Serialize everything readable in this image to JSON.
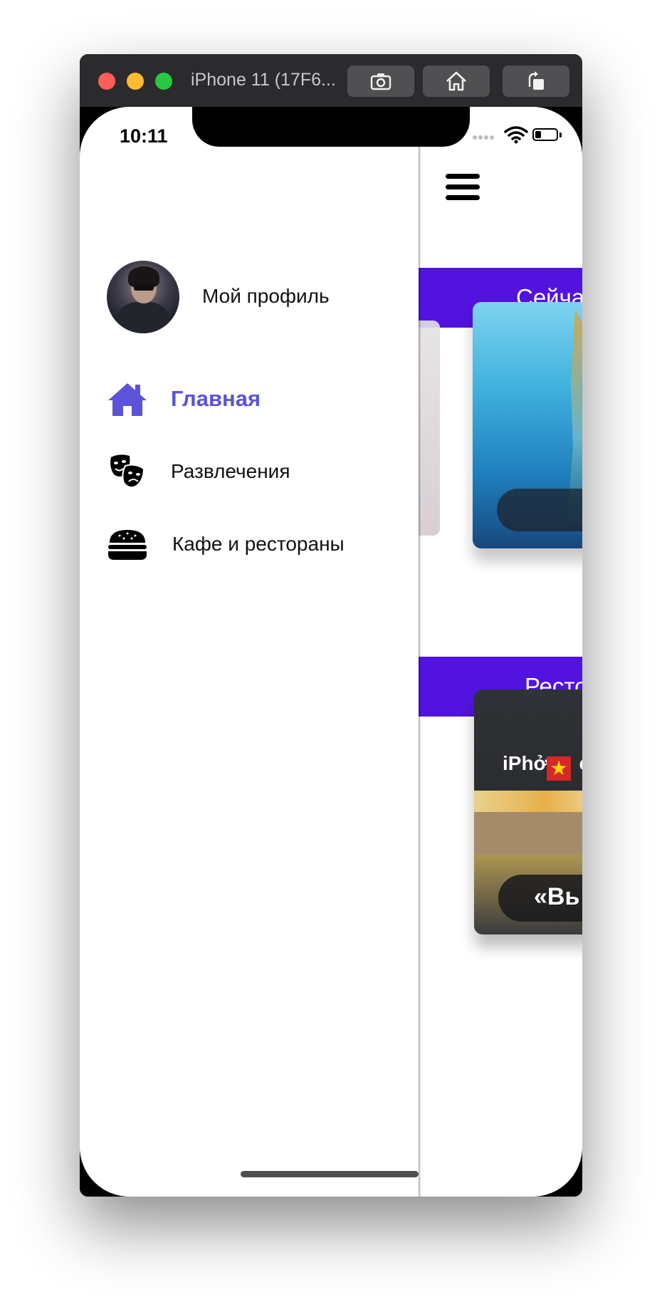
{
  "simulator": {
    "title": "iPhone 11 (17F6...",
    "buttons": {
      "screenshot": "screenshot-icon",
      "home": "home-icon",
      "rotate": "rotate-icon"
    }
  },
  "status_bar": {
    "time": "10:11"
  },
  "drawer": {
    "profile": {
      "label": "Мой профиль"
    },
    "items": [
      {
        "label": "Главная",
        "icon": "home-icon",
        "active": true
      },
      {
        "label": "Развлечения",
        "icon": "theater-masks-icon",
        "active": false
      },
      {
        "label": "Кафе и рестораны",
        "icon": "burger-icon",
        "active": false
      }
    ]
  },
  "main": {
    "sections": [
      {
        "title": "Сейча"
      },
      {
        "title": "Ресто"
      }
    ],
    "cards": {
      "restaurant_sign": "iPhở",
      "restaurant_sign_suffix": "c",
      "restaurant_title": "«Вь"
    }
  },
  "colors": {
    "accent": "#5b53d8",
    "section_bar": "#5213df"
  }
}
